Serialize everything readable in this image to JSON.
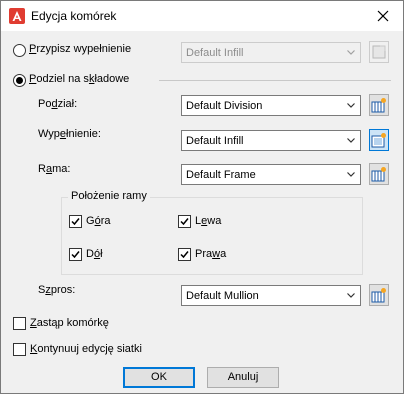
{
  "window": {
    "title": "Edycja komórek",
    "icon": "autocad-a-icon",
    "close_glyph": "✕",
    "accent_color": "#e03c31"
  },
  "fill_option": {
    "label_parts": [
      "P",
      "rzypisz wypełnienie"
    ],
    "selected": false,
    "select_value": "Default Infill",
    "select_enabled": false
  },
  "split_option": {
    "label_parts": [
      "P",
      "odziel na s",
      "k",
      "ładowe"
    ],
    "selected": true
  },
  "division": {
    "label_parts": [
      "Po",
      "d",
      "ział:"
    ],
    "value": "Default Division",
    "icon": "division-style-icon"
  },
  "infill": {
    "label_parts": [
      "Wyp",
      "e",
      "łnienie:"
    ],
    "value": "Default Infill",
    "icon": "infill-style-icon"
  },
  "frame": {
    "label_parts": [
      "R",
      "a",
      "ma:"
    ],
    "value": "Default Frame",
    "icon": "frame-style-icon"
  },
  "frame_position": {
    "title": "Położenie ramy",
    "top": {
      "label_parts": [
        "G",
        "ó",
        "ra"
      ],
      "checked": true
    },
    "left": {
      "label_parts": [
        "L",
        "e",
        "wa"
      ],
      "checked": true
    },
    "bottom": {
      "label_parts": [
        "D",
        "ó",
        "ł"
      ],
      "checked": true
    },
    "right": {
      "label_parts": [
        "Pra",
        "w",
        "a"
      ],
      "checked": true
    }
  },
  "mullion": {
    "label_parts": [
      "S",
      "z",
      "pros:"
    ],
    "value": "Default Mullion",
    "icon": "mullion-style-icon"
  },
  "replace_cell": {
    "label_parts": [
      "",
      "Z",
      "astąp komórkę"
    ],
    "checked": false
  },
  "continue_edit": {
    "label_parts": [
      "",
      "K",
      "ontynuuj edycję siatki"
    ],
    "checked": false
  },
  "buttons": {
    "ok": "OK",
    "cancel": "Anuluj"
  }
}
